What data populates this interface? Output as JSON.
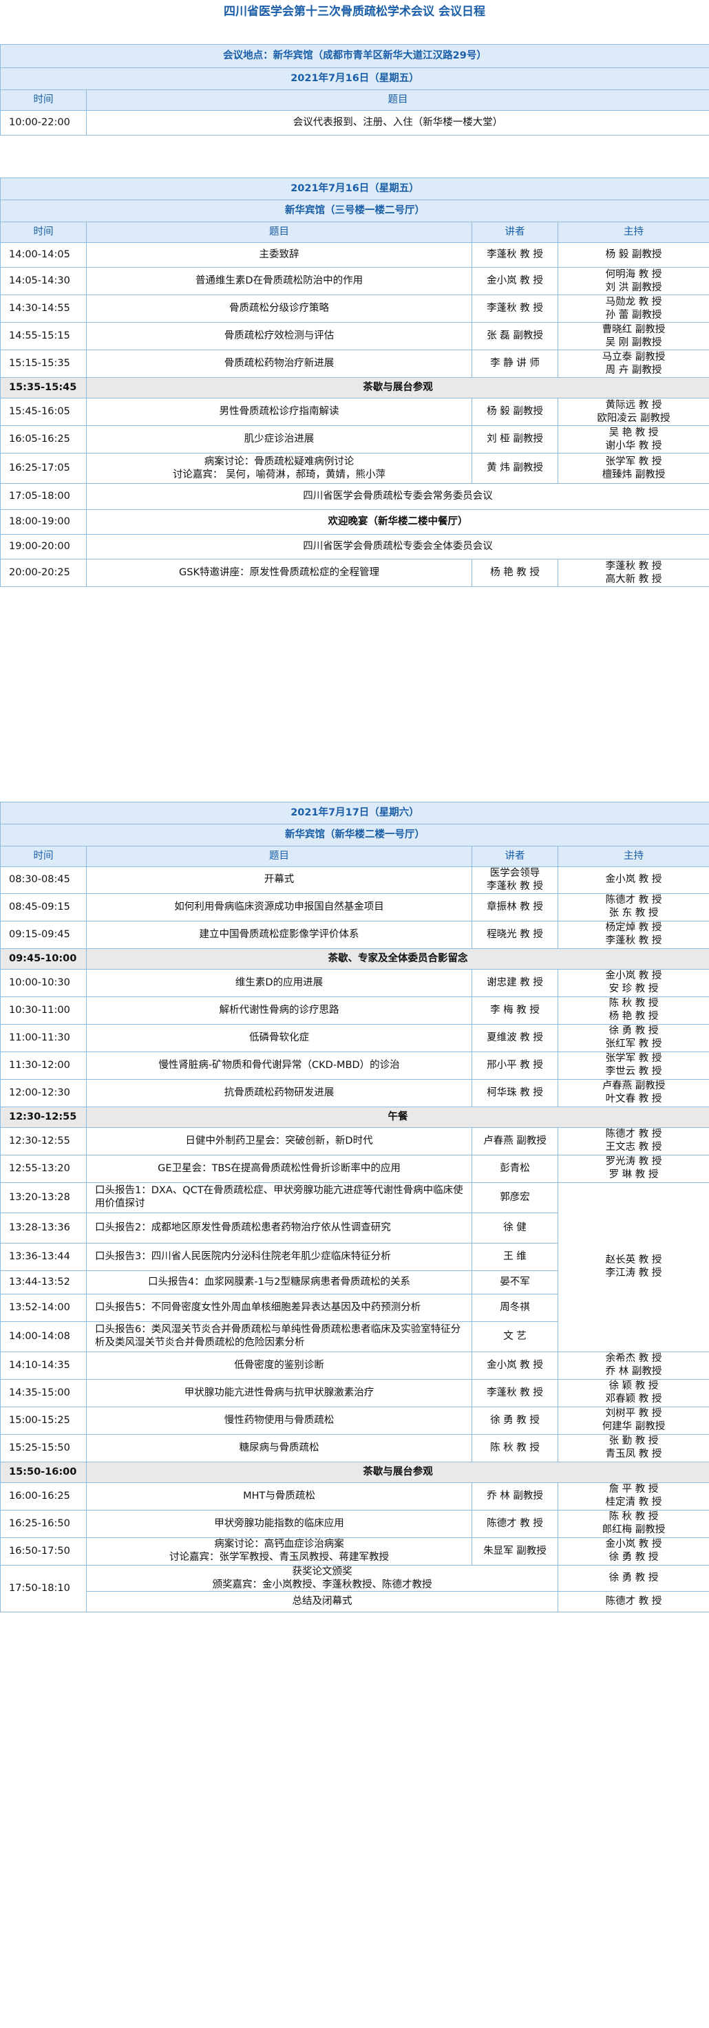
{
  "title": "四川省医学会第十三次骨质疏松学术会议 会议日程",
  "venue": "会议地点：新华宾馆（成都市青羊区新华大道江汉路29号）",
  "headers": {
    "time": "时间",
    "topic": "题目",
    "speaker": "讲者",
    "host": "主持"
  },
  "section1": {
    "date": "2021年7月16日（星期五）",
    "rows": [
      {
        "time": "10:00-22:00",
        "topic": "会议代表报到、注册、入住（新华楼一楼大堂）"
      }
    ]
  },
  "section2": {
    "date": "2021年7月16日（星期五）",
    "hall": "新华宾馆（三号楼一楼二号厅）",
    "rows": [
      {
        "time": "14:00-14:05",
        "topic": "主委致辞",
        "speaker": "李蓬秋 教 授",
        "host": "杨 毅 副教授"
      },
      {
        "time": "14:05-14:30",
        "topic": "普通维生素D在骨质疏松防治中的作用",
        "speaker": "金小岚 教 授",
        "host": "何明海 教 授\n刘 洪 副教授"
      },
      {
        "time": "14:30-14:55",
        "topic": "骨质疏松分级诊疗策略",
        "speaker": "李蓬秋 教 授",
        "host": "马勋龙 教 授\n孙 蕾 副教授"
      },
      {
        "time": "14:55-15:15",
        "topic": "骨质疏松疗效检测与评估",
        "speaker": "张 磊 副教授",
        "host": "曹晓红 副教授\n吴 刚 副教授"
      },
      {
        "time": "15:15-15:35",
        "topic": "骨质疏松药物治疗新进展",
        "speaker": "李 静 讲 师",
        "host": "马立泰 副教授\n周 卉 副教授"
      },
      {
        "time": "15:35-15:45",
        "topic": "茶歇与展台参观",
        "gray": true
      },
      {
        "time": "15:45-16:05",
        "topic": "男性骨质疏松诊疗指南解读",
        "speaker": "杨 毅 副教授",
        "host": "黄际远 教 授\n欧阳凌云 副教授"
      },
      {
        "time": "16:05-16:25",
        "topic": "肌少症诊治进展",
        "speaker": "刘 桠 副教授",
        "host": "吴 艳 教 授\n谢小华 教 授"
      },
      {
        "time": "16:25-17:05",
        "topic": "病案讨论：骨质疏松疑难病例讨论\n讨论嘉宾：  吴何，喻荷淋，郝琦，黄婧，熊小萍",
        "speaker": "黄 炜 副教授",
        "host": "张学军 教 授\n檀臻炜 副教授"
      },
      {
        "time": "17:05-18:00",
        "topic": "四川省医学会骨质疏松专委会常务委员会议"
      },
      {
        "time": "18:00-19:00",
        "topic": "欢迎晚宴（新华楼二楼中餐厅）",
        "bold": true
      },
      {
        "time": "19:00-20:00",
        "topic": "四川省医学会骨质疏松专委会全体委员会议"
      },
      {
        "time": "20:00-20:25",
        "topic": "GSK特邀讲座：原发性骨质疏松症的全程管理",
        "speaker": "杨 艳 教 授",
        "host": "李蓬秋 教 授\n高大新 教 授"
      }
    ]
  },
  "section3": {
    "date": "2021年7月17日（星期六）",
    "hall": "新华宾馆（新华楼二楼一号厅）",
    "rows": [
      {
        "time": "08:30-08:45",
        "topic": "开幕式",
        "speaker": "医学会领导\n李蓬秋 教 授",
        "host": "金小岚 教 授"
      },
      {
        "time": "08:45-09:15",
        "topic": "如何利用骨病临床资源成功申报国自然基金项目",
        "speaker": "章振林 教 授",
        "host": "陈德才 教 授\n张 东 教 授"
      },
      {
        "time": "09:15-09:45",
        "topic": "建立中国骨质疏松症影像学评价体系",
        "speaker": "程晓光 教 授",
        "host": "杨定焯 教 授\n李蓬秋 教 授"
      },
      {
        "time": "09:45-10:00",
        "topic": "茶歇、专家及全体委员合影留念",
        "gray": true
      },
      {
        "time": "10:00-10:30",
        "topic": "维生素D的应用进展",
        "speaker": "谢忠建 教 授",
        "host": "金小岚 教 授\n安 珍 教 授"
      },
      {
        "time": "10:30-11:00",
        "topic": "解析代谢性骨病的诊疗思路",
        "speaker": "李 梅 教 授",
        "host": "陈 秋 教 授\n杨 艳 教 授"
      },
      {
        "time": "11:00-11:30",
        "topic": "低磷骨软化症",
        "speaker": "夏维波 教 授",
        "host": "徐 勇 教 授\n张红军 教 授"
      },
      {
        "time": "11:30-12:00",
        "topic": "慢性肾脏病-矿物质和骨代谢异常（CKD-MBD）的诊治",
        "speaker": "邢小平 教 授",
        "host": "张学军 教 授\n李世云 教 授"
      },
      {
        "time": "12:00-12:30",
        "topic": "抗骨质疏松药物研发进展",
        "speaker": "柯华珠 教 授",
        "host": "卢春燕 副教授\n叶文春 教 授"
      },
      {
        "time": "12:30-12:55",
        "topic": "午餐",
        "gray": true
      },
      {
        "time": "12:30-12:55",
        "topic": "日健中外制药卫星会：突破创新，新D时代",
        "speaker": "卢春燕 副教授",
        "host": "陈德才 教 授\n王文志 教 授"
      },
      {
        "time": "12:55-13:20",
        "topic": "GE卫星会：TBS在提高骨质疏松性骨折诊断率中的应用",
        "speaker": "彭青松",
        "host": "罗光涛 教 授\n罗 琳 教 授"
      },
      {
        "time": "13:20-13:28",
        "topic": "口头报告1：DXA、QCT在骨质疏松症、甲状旁腺功能亢进症等代谢性骨病中临床使用价值探讨",
        "speaker": "郭彦宏",
        "left": true
      },
      {
        "time": "13:28-13:36",
        "topic": "口头报告2：成都地区原发性骨质疏松患者药物治疗依从性调查研究",
        "speaker": "徐 健",
        "left": true
      },
      {
        "time": "13:36-13:44",
        "topic": "口头报告3：四川省人民医院内分泌科住院老年肌少症临床特征分析",
        "speaker": "王 维",
        "left": true
      },
      {
        "time": "13:44-13:52",
        "topic": "口头报告4：血浆网膜素-1与2型糖尿病患者骨质疏松的关系",
        "speaker": "晏不军"
      },
      {
        "time": "13:52-14:00",
        "topic": "口头报告5：不同骨密度女性外周血单核细胞差异表达基因及中药预测分析",
        "speaker": "周冬祺",
        "left": true
      },
      {
        "time": "14:00-14:08",
        "topic": "口头报告6：类风湿关节炎合并骨质疏松与单纯性骨质疏松患者临床及实验室特征分析及类风湿关节炎合并骨质疏松的危险因素分析",
        "speaker": "文 艺",
        "left": true
      },
      {
        "time": "14:10-14:35",
        "topic": "低骨密度的鉴别诊断",
        "speaker": "金小岚 教 授",
        "host": "余希杰 教 授\n乔 林 副教授"
      },
      {
        "time": "14:35-15:00",
        "topic": "甲状腺功能亢进性骨病与抗甲状腺激素治疗",
        "speaker": "李蓬秋 教 授",
        "host": "徐 颖 教 授\n邓春颖 教 授"
      },
      {
        "time": "15:00-15:25",
        "topic": "慢性药物使用与骨质疏松",
        "speaker": "徐 勇 教 授",
        "host": "刘树平 教 授\n何建华 副教授"
      },
      {
        "time": "15:25-15:50",
        "topic": "糖尿病与骨质疏松",
        "speaker": "陈 秋 教 授",
        "host": "张 勤 教 授\n青玉凤 教 授"
      },
      {
        "time": "15:50-16:00",
        "topic": "茶歇与展台参观",
        "gray": true
      },
      {
        "time": "16:00-16:25",
        "topic": "MHT与骨质疏松",
        "speaker": "乔 林 副教授",
        "host": "詹 平 教 授\n桂定清 教 授"
      },
      {
        "time": "16:25-16:50",
        "topic": "甲状旁腺功能指数的临床应用",
        "speaker": "陈德才 教 授",
        "host": "陈 秋 教 授\n郎红梅 副教授"
      },
      {
        "time": "16:50-17:50",
        "topic": "病案讨论：高钙血症诊治病案\n讨论嘉宾：张学军教授、青玉凤教授、蒋建军教授",
        "speaker": "朱显军 副教授",
        "host": "金小岚 教 授\n徐 勇 教 授"
      },
      {
        "time": "17:50-18:10",
        "topic": "获奖论文颁奖\n颁奖嘉宾：金小岚教授、李蓬秋教授、陈德才教授",
        "host": "徐 勇 教 授"
      },
      {
        "topic": "总结及闭幕式",
        "host": "陈德才 教 授"
      }
    ],
    "oral_host": "赵长英 教 授\n李江涛 教 授"
  }
}
